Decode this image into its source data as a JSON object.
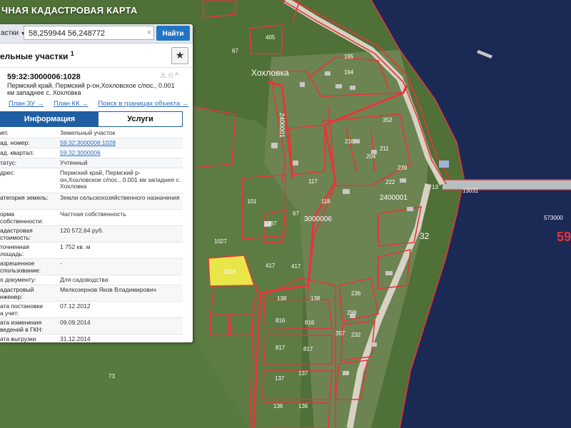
{
  "app": {
    "title": "ЧНАЯ КАДАСТРОВАЯ КАРТА"
  },
  "search": {
    "type_label": "астки",
    "query": "58,259944 56,248772",
    "clear_glyph": "×",
    "button_label": "Найти"
  },
  "layer": {
    "title": "ельные участки",
    "footnote": "1",
    "star_glyph": "★"
  },
  "card": {
    "id": "59:32:3000006:1028",
    "icons": "⚠✩^",
    "address": "Пермский край, Пермский р-он,Хохловское с/пос., 0.001 км западнее с. Хохловка",
    "links": [
      "План ЗУ →",
      "План КК →",
      "Поиск в границах объекта →"
    ]
  },
  "tabs": {
    "info": "Информация",
    "services": "Услуги"
  },
  "attributes": [
    {
      "key": "ип:",
      "value": "Земельный участок",
      "link": false,
      "h": 13
    },
    {
      "key": "ад. номер:",
      "value": "59:32:3000006:1028",
      "link": true,
      "h": 13
    },
    {
      "key": "ад. квартал:",
      "value": "59:32:3000006",
      "link": true,
      "h": 13
    },
    {
      "key": "татус:",
      "value": "Учтенный",
      "link": false,
      "h": 13
    },
    {
      "key": "дрес:",
      "value": "Пермский край, Пермский р-он,Хохловское с/пос., 0.001 км западнее с. Хохловка",
      "link": false,
      "h": 34
    },
    {
      "key": "атегория земель:",
      "value": "Земли сельскохозяйственного назначения",
      "link": false,
      "h": 22
    },
    {
      "key": "орма\nсобственности:",
      "value": "Частная собственность",
      "link": false,
      "h": 22
    },
    {
      "key": "адастровая\nстоимость:",
      "value": "120 572,64 руб.",
      "link": false,
      "h": 22
    },
    {
      "key": "точненная\nлощадь:",
      "value": "1 752 кв. м",
      "link": false,
      "h": 22
    },
    {
      "key": "азрешенное\nспользование:",
      "value": "-",
      "link": false,
      "h": 22
    },
    {
      "key": "о документу:",
      "value": "Для садоводства",
      "link": false,
      "h": 13
    },
    {
      "key": "адастровый\nнженер:",
      "value": "Мелкозернов Яков Владимирович",
      "link": false,
      "h": 22
    },
    {
      "key": "ата постановки\nа учет:",
      "value": "07.12.2012",
      "link": false,
      "h": 22
    },
    {
      "key": "ата изменения\nведений в ГКН:",
      "value": "09.09.2014",
      "link": false,
      "h": 22
    },
    {
      "key": "ата выгрузки\nведений из ГКН:",
      "value": "31.12.2014",
      "link": false,
      "h": 22
    }
  ],
  "map": {
    "village_name": "Хохловка",
    "labels": [
      "405",
      "67",
      "195",
      "194",
      "2400001",
      "352",
      "216",
      "204",
      "211",
      "239",
      "222",
      "13",
      "1367",
      "117",
      "101",
      "118",
      "67",
      "3000006",
      "2400001",
      "1027",
      "1028",
      "417",
      "417",
      "138",
      "138",
      "298",
      "236",
      "816",
      "816",
      "357",
      "232",
      "817",
      "817",
      "137",
      "137",
      "136",
      "136",
      "73",
      "32",
      "13031",
      "573000",
      "59"
    ],
    "colors": {
      "parcel": "#e8353a",
      "water": "#1b2a55",
      "selected": "#e9e64a",
      "vegetation": "#4f7037"
    }
  }
}
